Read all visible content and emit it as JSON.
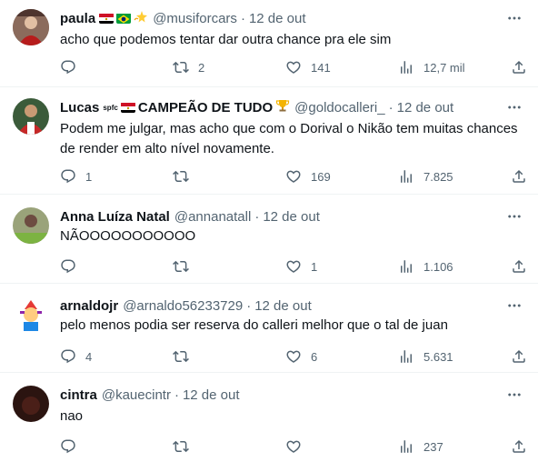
{
  "tweets": [
    {
      "name": "paula",
      "handle": "@musiforcars",
      "date": "12 de out",
      "text": "acho que podemos tentar dar outra chance pra ele sim",
      "replies": "",
      "retweets": "2",
      "likes": "141",
      "views": "12,7 mil",
      "name_icons": [
        "egypt-flag-icon",
        "brazil-flag-icon",
        "dizzy-star-icon"
      ]
    },
    {
      "name": "Lucas",
      "name_suffix_small": "spfc",
      "name_suffix": "CAMPEÃO DE TUDO",
      "handle": "@goldocalleri_",
      "date": "12 de out",
      "text": "Podem me julgar, mas acho que com o Dorival o Nikão tem muitas chances de render em alto nível novamente.",
      "replies": "1",
      "retweets": "",
      "likes": "169",
      "views": "7.825",
      "name_icons": [
        "egypt-flag-icon",
        "trophy-icon"
      ]
    },
    {
      "name": "Anna Luíza Natal",
      "handle": "@annanatall",
      "date": "12 de out",
      "text": "NÃOOOOOOOOOOO",
      "replies": "",
      "retweets": "",
      "likes": "1",
      "views": "1.106"
    },
    {
      "name": "arnaldojr",
      "handle": "@arnaldo56233729",
      "date": "12 de out",
      "text": "pelo menos podia ser reserva do calleri melhor que o tal de juan",
      "replies": "4",
      "retweets": "",
      "likes": "6",
      "views": "5.631"
    },
    {
      "name": "cintra",
      "handle": "@kauecintr",
      "date": "12 de out",
      "text": "nao",
      "replies": "",
      "retweets": "",
      "likes": "",
      "views": "237"
    }
  ],
  "separator": "·",
  "colors": {
    "text": "#0f1419",
    "muted": "#536471",
    "divider": "#eff3f4"
  }
}
